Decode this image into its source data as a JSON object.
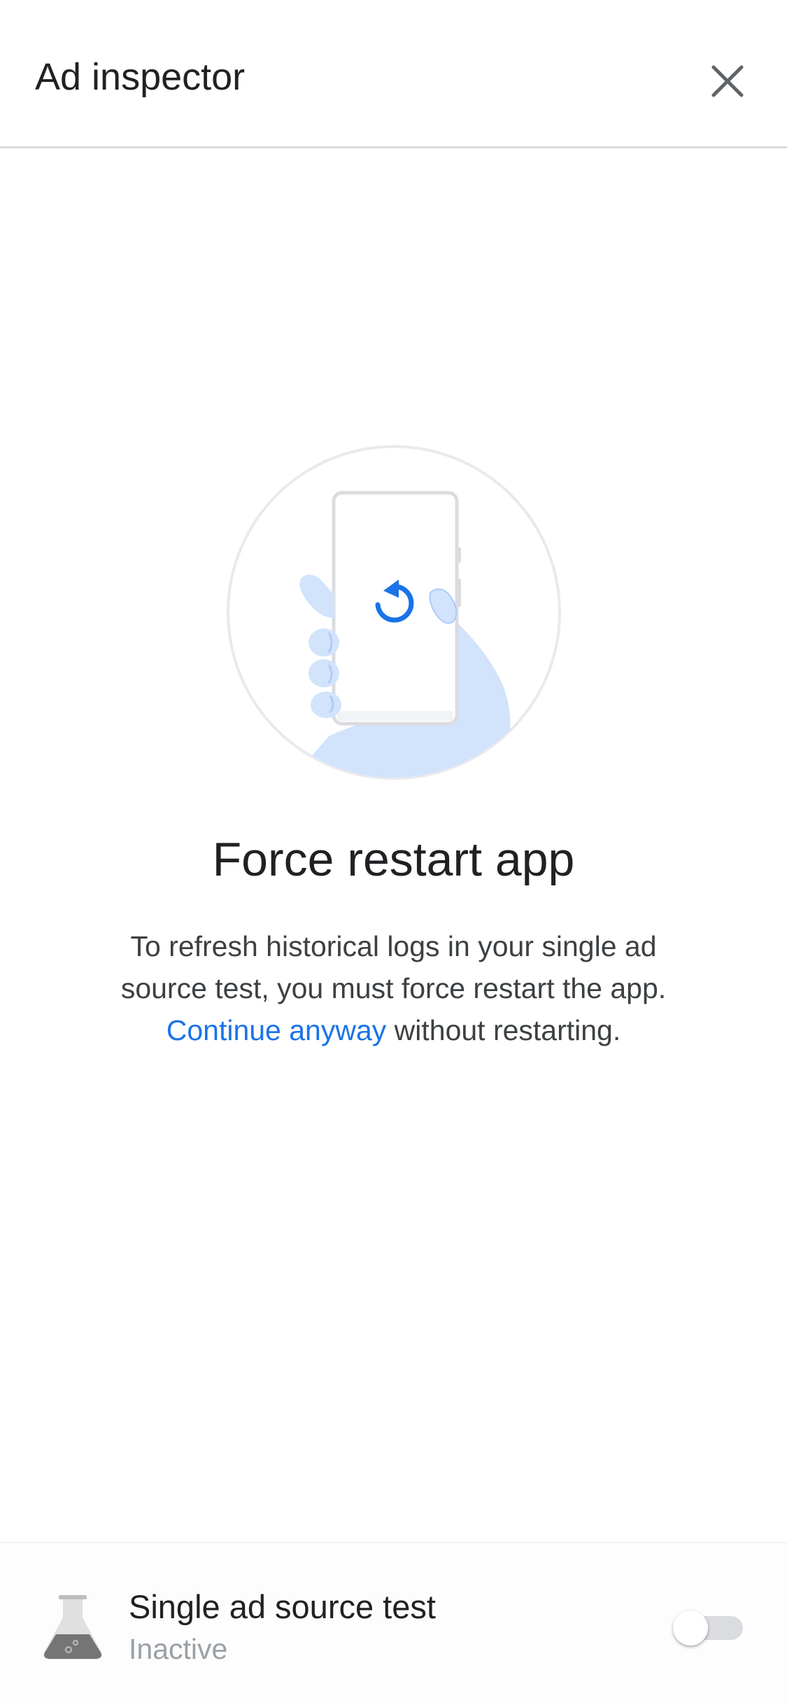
{
  "header": {
    "title": "Ad inspector",
    "close_icon": "close-icon"
  },
  "illustration": {
    "icon": "phone-restart-illustration",
    "accent_color": "#1a73e8",
    "hand_color": "#d2e3fc"
  },
  "main": {
    "headline": "Force restart app",
    "body_line": "To refresh historical logs in your single ad source test, you must force restart the app.",
    "link_label": "Continue anyway",
    "link_suffix": " without restarting."
  },
  "bottom": {
    "icon": "flask-icon",
    "title": "Single ad source test",
    "status": "Inactive",
    "toggle_on": false
  },
  "colors": {
    "link": "#1a73e8",
    "text_primary": "#202124",
    "text_secondary": "#3c4043",
    "status_inactive": "#9aa0a6"
  }
}
